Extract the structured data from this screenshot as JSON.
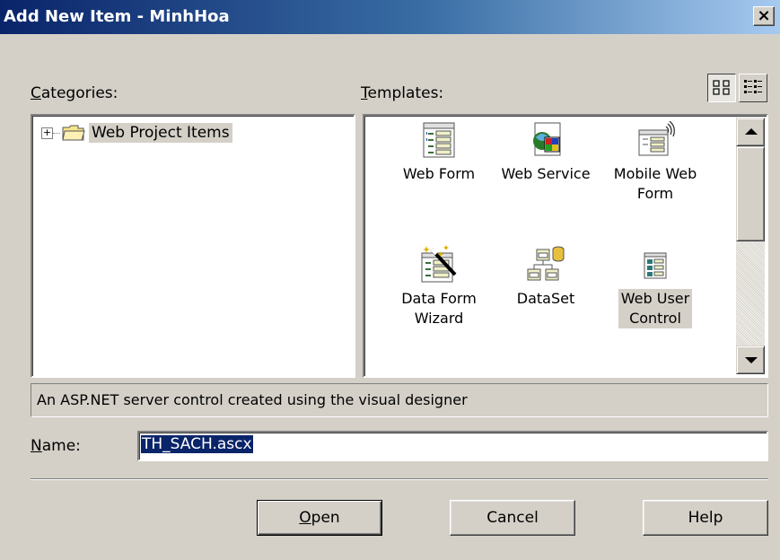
{
  "window": {
    "title": "Add New Item - MinhHoa",
    "close_symbol": "×"
  },
  "categories": {
    "label_accel": "C",
    "label_rest": "ategories:",
    "items": [
      {
        "label": "Web Project Items",
        "expander": "+"
      }
    ]
  },
  "templates": {
    "label_accel": "T",
    "label_rest": "emplates:",
    "items": [
      {
        "icon": "web-form-icon",
        "line1": "Web Form",
        "line2": ""
      },
      {
        "icon": "web-service-icon",
        "line1": "Web Service",
        "line2": ""
      },
      {
        "icon": "mobile-web-form-icon",
        "line1": "Mobile Web",
        "line2": "Form"
      },
      {
        "icon": "data-form-wizard-icon",
        "line1": "Data Form",
        "line2": "Wizard"
      },
      {
        "icon": "dataset-icon",
        "line1": "DataSet",
        "line2": ""
      },
      {
        "icon": "web-user-control-icon",
        "line1": "Web User",
        "line2": "Control"
      }
    ],
    "selected": "Web User Control"
  },
  "description": "An ASP.NET server control created using the visual designer",
  "name_field": {
    "label_accel": "N",
    "label_rest": "ame:",
    "value": "TH_SACH.ascx"
  },
  "buttons": {
    "open_accel": "O",
    "open_rest": "pen",
    "cancel": "Cancel",
    "help": "Help"
  },
  "colors": {
    "title_start": "#0a246a",
    "title_end": "#a6caf0",
    "face": "#d4d0c8",
    "selection": "#0a246a"
  }
}
